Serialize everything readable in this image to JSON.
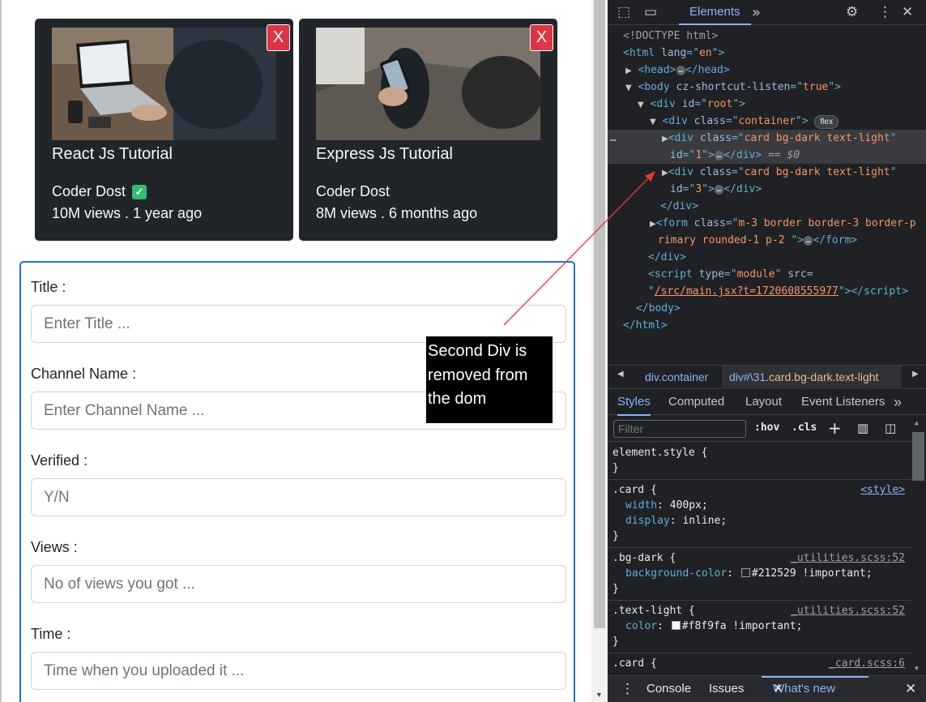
{
  "cards": [
    {
      "title": "React Js Tutorial",
      "channel": "Coder Dost",
      "verified": true,
      "views": "10M views . 1 year ago",
      "close_label": "X"
    },
    {
      "title": "Express Js Tutorial",
      "channel": "Coder Dost",
      "verified": false,
      "views": "8M views . 6 months ago",
      "close_label": "X"
    }
  ],
  "form": {
    "fields": [
      {
        "label": "Title :",
        "placeholder": "Enter Title ..."
      },
      {
        "label": "Channel Name :",
        "placeholder": "Enter Channel Name ..."
      },
      {
        "label": "Verified :",
        "placeholder": "Y/N"
      },
      {
        "label": "Views :",
        "placeholder": "No of views you got ..."
      },
      {
        "label": "Time :",
        "placeholder": "Time when you uploaded it ..."
      }
    ]
  },
  "annotation": {
    "line1": "Second Div is",
    "line2": "removed from",
    "line3": "the dom"
  },
  "devtools": {
    "main_tab": "Elements",
    "dom": {
      "doctype": "<!DOCTYPE html>",
      "html_lang": "en",
      "body_attr": "cz-shortcut-listen",
      "body_attr_val": "true",
      "root_id": "root",
      "container_class": "container",
      "flex_badge": "flex",
      "card_class": "card bg-dark text-light",
      "card1_id": "1",
      "card3_id": "3",
      "selected_marker": "== $0",
      "form_class_part1": "m-3 border border-3 border-p",
      "form_class_part2": "rimary rounded-1 p-2 ",
      "script_type": "module",
      "script_src_label": "src=",
      "script_src": "/src/main.jsx?t=1720608555977",
      "sel_dots": "…",
      "ellipsis": "…"
    },
    "breadcrumb": {
      "item1": "div.container",
      "item2_prefix": "div#\\31",
      "item2_rest": ".card.bg-dark.text-light"
    },
    "style_tabs": [
      "Styles",
      "Computed",
      "Layout",
      "Event Listeners"
    ],
    "filter_placeholder": "Filter",
    "hov": ":hov",
    "cls": ".cls",
    "rules": {
      "element_style": "element.style {",
      "close": "}",
      "card_sel": ".card {",
      "card_src": "<style>",
      "card_props": [
        {
          "name": "width",
          "value": "400px;"
        },
        {
          "name": "display",
          "value": "inline;"
        }
      ],
      "bgdark_sel": ".bg-dark {",
      "bgdark_src": "_utilities.scss:52",
      "bgdark_prop": "background-color",
      "bgdark_val": "#212529 !important;",
      "bgdark_color": "#212529",
      "textlight_sel": ".text-light {",
      "textlight_src": "_utilities.scss:52",
      "textlight_prop": "color",
      "textlight_val": "#f8f9fa !important;",
      "textlight_color": "#f8f9fa",
      "card2_sel": ".card {",
      "card2_src": "_card.scss:6"
    },
    "drawer": {
      "tabs": [
        "Console",
        "Issues",
        "What's new"
      ]
    }
  },
  "colors": {
    "card_bg": "#212529",
    "close_btn": "#dc3545",
    "form_border": "#1f6fe0",
    "verified_badge": "#2fbf71",
    "devtools_bg": "#202124"
  }
}
